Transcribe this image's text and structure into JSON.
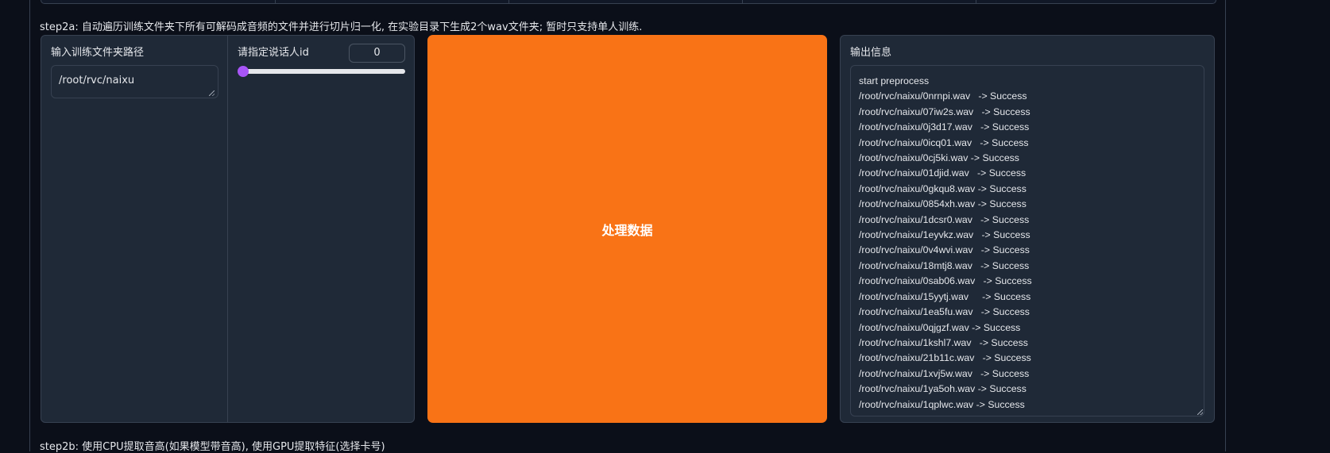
{
  "step2a": {
    "description": "step2a: 自动遍历训练文件夹下所有可解码成音频的文件并进行切片归一化, 在实验目录下生成2个wav文件夹; 暂时只支持单人训练."
  },
  "input_folder": {
    "label": "输入训练文件夹路径",
    "value": "/root/rvc/naixu"
  },
  "speaker_id": {
    "label": "请指定说话人id",
    "value": "0",
    "slider_value": 0,
    "slider_min": 0,
    "slider_max": 4
  },
  "process_button": {
    "label": "处理数据"
  },
  "output": {
    "label": "输出信息",
    "lines": [
      "start preprocess",
      "/root/rvc/naixu/0nrnpi.wav   -> Success",
      "/root/rvc/naixu/07iw2s.wav   -> Success",
      "/root/rvc/naixu/0j3d17.wav   -> Success",
      "/root/rvc/naixu/0icq01.wav   -> Success",
      "/root/rvc/naixu/0cj5ki.wav -> Success",
      "/root/rvc/naixu/01djid.wav   -> Success",
      "/root/rvc/naixu/0gkqu8.wav -> Success",
      "/root/rvc/naixu/0854xh.wav -> Success",
      "/root/rvc/naixu/1dcsr0.wav   -> Success",
      "/root/rvc/naixu/1eyvkz.wav   -> Success",
      "/root/rvc/naixu/0v4wvi.wav   -> Success",
      "/root/rvc/naixu/18mtj8.wav   -> Success",
      "/root/rvc/naixu/0sab06.wav   -> Success",
      "/root/rvc/naixu/15yytj.wav     -> Success",
      "/root/rvc/naixu/1ea5fu.wav   -> Success",
      "/root/rvc/naixu/0qjgzf.wav -> Success",
      "/root/rvc/naixu/1kshl7.wav   -> Success",
      "/root/rvc/naixu/21b11c.wav   -> Success",
      "/root/rvc/naixu/1xvj5w.wav   -> Success",
      "/root/rvc/naixu/1ya5oh.wav -> Success",
      "/root/rvc/naixu/1qplwc.wav -> Success"
    ]
  },
  "step2b": {
    "description": "step2b: 使用CPU提取音高(如果模型带音高), 使用GPU提取特征(选择卡号)"
  },
  "colors": {
    "background": "#0b0f19",
    "panel": "#1f2937",
    "border": "#374151",
    "accent_button": "#f97316",
    "slider_thumb": "#a855f7"
  }
}
